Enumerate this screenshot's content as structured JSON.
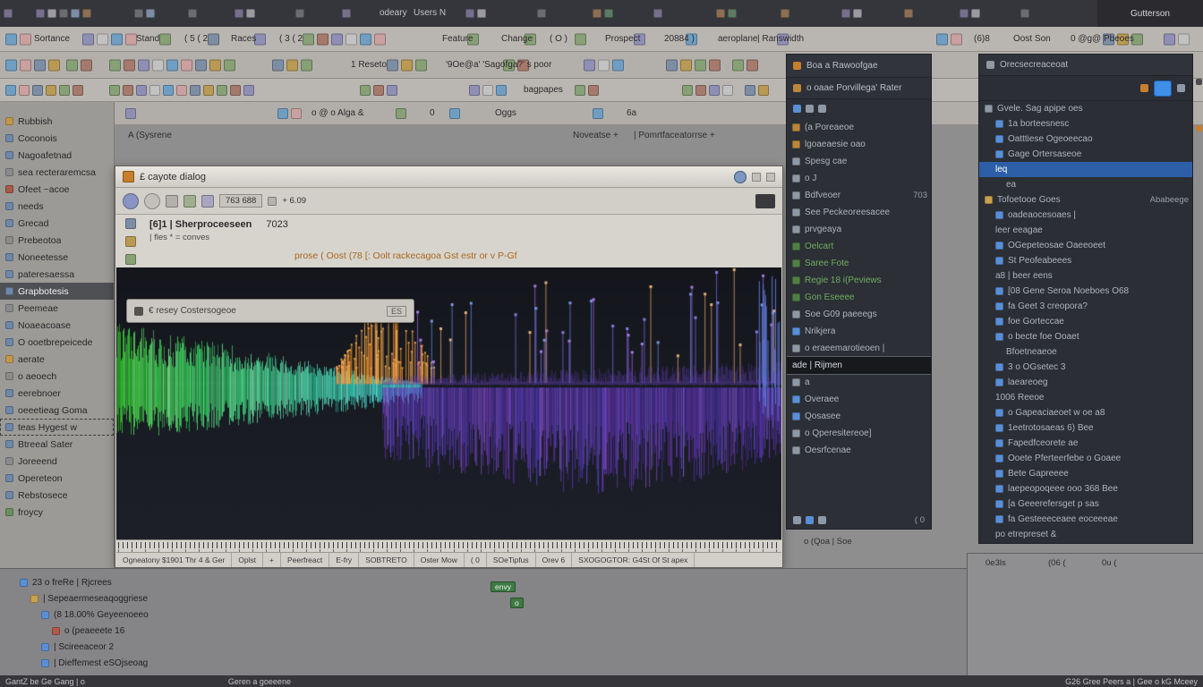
{
  "menubar": {
    "labels": [
      "odeary",
      "Users N"
    ],
    "right_label": "Gutterson"
  },
  "toolbar1": {
    "labels": [
      "Sortance",
      "Stand",
      "( 5 ( 2",
      "Races",
      "( 3 ( 2",
      "Feature",
      "Change",
      "( O )",
      "Prospect",
      "20884 )",
      "aeroplane",
      "| Ranswidth",
      "(6)8",
      "Oost Son",
      "0 @g@ Pbeoes"
    ]
  },
  "toolbar2": {
    "labels": [
      "1 Reseto",
      "'9Oe@a' 'Sagofga?' s poor"
    ]
  },
  "toolbar3": {
    "labels": [
      "bagpapes"
    ]
  },
  "address_row": {
    "labels": [
      "o @ o Alga &",
      "0",
      "Oggs",
      "6a"
    ]
  },
  "sub_row": {
    "labels": [
      "A (Sysrene",
      "Noveatse +",
      "| Pomrtfaceatorrse +"
    ]
  },
  "sidebar": {
    "items": [
      {
        "t": "Rubbish",
        "c": "#c2974d"
      },
      {
        "t": "Coconois",
        "c": "#6f87a8"
      },
      {
        "t": "Nagoafetnad",
        "c": "#6f87a8"
      },
      {
        "t": "sea recteraremcsa",
        "c": "#8b8b8b"
      },
      {
        "t": "Ofeet ~acoe",
        "c": "#a85a4a"
      },
      {
        "t": "needs",
        "c": "#6f87a8"
      },
      {
        "t": "Grecad",
        "c": "#6f87a8"
      },
      {
        "t": "Prebeotoa",
        "c": "#8b8b8b"
      },
      {
        "t": "Noneetesse",
        "c": "#6f87a8"
      },
      {
        "t": "pateresaessa",
        "c": "#6f87a8"
      },
      {
        "t": "Grapbotesis",
        "c": "#6f87a8",
        "sel": "dark"
      },
      {
        "t": "Peemeae",
        "c": "#8b8b8b"
      },
      {
        "t": "Noaeacoase",
        "c": "#6f87a8"
      },
      {
        "t": "O ooetbrepeicede",
        "c": "#6f87a8"
      },
      {
        "t": "aerate",
        "c": "#c2974d"
      },
      {
        "t": "o aeoech",
        "c": "#8b8b8b"
      },
      {
        "t": "eerebnoer",
        "c": "#6f87a8"
      },
      {
        "t": "oeeetieag Goma",
        "c": "#6f87a8"
      },
      {
        "t": "teas Hygest w",
        "c": "#6f87a8",
        "sel": "outline"
      },
      {
        "t": "Btreeal Sater",
        "c": "#6f87a8"
      },
      {
        "t": "Joreeend",
        "c": "#8b8b8b"
      },
      {
        "t": "Opereteon",
        "c": "#6f87a8"
      },
      {
        "t": "Rebstosece",
        "c": "#6f87a8"
      },
      {
        "t": "froycy",
        "c": "#6a8f5f"
      }
    ]
  },
  "window": {
    "title": "£ cayote dialog",
    "toolbar": {
      "value1": "763 688",
      "value2": "+ 6.09"
    },
    "header": {
      "line1": "[6]1 | Sherproceeseen",
      "value": "7023",
      "line2": "| fles * = conves",
      "banner": "prose ( Oost (78 [: Oolt rackecagoa Gst estr or v P-Gf"
    },
    "search": {
      "text": "€ resey Costersogeoe",
      "badge": "ES"
    },
    "statusbar": [
      "Ogneatony $1901 Thr 4 & Ger",
      "Oplst",
      "+",
      "Peerfreact",
      "E-fry",
      "SOBTRETO",
      "Oster Mow",
      "( 0",
      "SOeTipfus",
      "Orev 6",
      "SXOGOGTOR: G4St Of St apex"
    ]
  },
  "spectrogram": {
    "bg_top": "#14161c",
    "bg_bottom": "#1d2029",
    "baseline_frac": 0.435,
    "left_band": {
      "color_start": 118,
      "color_end": 186,
      "x0": 0.0,
      "x1": 0.46
    },
    "orange_cluster": {
      "x0": 0.33,
      "x1": 0.48,
      "hue": 32
    },
    "upper_spikes": {
      "x0": 0.45,
      "x1": 1.0,
      "hues": [
        250,
        265,
        225,
        30
      ]
    },
    "purple_band": {
      "x0": 0.4,
      "x1": 1.0,
      "hue": 258
    },
    "seed": 7
  },
  "right_panel1": {
    "header1": "Boa a Rawoofgae",
    "header2": "o oaae Porvillega' Rater",
    "items": [
      {
        "t": "(a Poreaeoe",
        "c": "#b8873b"
      },
      {
        "t": "lgoaeaesie oao",
        "c": "#b8873b"
      },
      {
        "t": "Spesg cae",
        "c": "#8f98a5"
      },
      {
        "t": "o J",
        "c": "#8f98a5"
      },
      {
        "t": "Bdfveoer",
        "c": "#8f98a5",
        "r": "703"
      },
      {
        "t": "See Peckeoreesacee",
        "c": "#8f98a5"
      },
      {
        "t": "prvgeaya",
        "c": "#8f98a5"
      },
      {
        "t": "Oelcart",
        "c": "#4f7f45",
        "fg": "#6fae5f"
      },
      {
        "t": "Saree Fote",
        "c": "#4f7f45",
        "fg": "#6fae5f"
      },
      {
        "t": "Regie 18 i(Peviews",
        "c": "#4f7f45",
        "fg": "#6fae5f"
      },
      {
        "t": "Gon Eseeee",
        "c": "#4f7f45",
        "fg": "#6fae5f"
      },
      {
        "t": "Soe G09 paeeegs",
        "c": "#8f98a5"
      },
      {
        "t": "Nrikjera",
        "c": "#5a8fd6"
      },
      {
        "t": "o eraeemarotieoen |",
        "c": "#8f98a5"
      },
      {
        "t": "ade | Rijmen",
        "sel": "tooltip"
      },
      {
        "t": "a",
        "c": "#8f98a5"
      },
      {
        "t": "Overaee",
        "c": "#5a8fd6"
      },
      {
        "t": "Qosasee",
        "c": "#5a8fd6"
      },
      {
        "t": "o Qperesitereoe]",
        "c": "#8f98a5"
      },
      {
        "t": "Oesrfcenae",
        "c": "#8f98a5"
      }
    ],
    "footer_value": "( 0"
  },
  "mid_strip": {
    "label": "o    (Qoa    | Soe"
  },
  "right_panel2": {
    "header": "Orecsecreaceoat",
    "items": [
      {
        "t": "Gvele. Sag apipe oes",
        "i": 0,
        "c": "#8f98a5"
      },
      {
        "t": "1a borteesnesc",
        "i": 1,
        "c": "#5a8fd6"
      },
      {
        "t": "Oatttiese Ogeoeecao",
        "i": 1,
        "c": "#5a8fd6"
      },
      {
        "t": "Gage Ortersaseoe",
        "i": 1,
        "c": "#5a8fd6"
      },
      {
        "t": "leq",
        "i": 1,
        "sel": "blue"
      },
      {
        "t": "ea",
        "i": 2
      },
      {
        "t": "Tofoetooe Goes",
        "i": 0,
        "c": "#c9a14d",
        "r": "Ababeege"
      },
      {
        "t": "oadeaocesoaes |",
        "i": 1,
        "c": "#5a8fd6"
      },
      {
        "t": "leer eeagae",
        "i": 1
      },
      {
        "t": "OGepeteosae Oaeeoeet",
        "i": 1,
        "c": "#5a8fd6"
      },
      {
        "t": "St Peofeabeees",
        "i": 1,
        "c": "#5a8fd6"
      },
      {
        "t": "a8 | beer eens",
        "i": 1
      },
      {
        "t": "[08 Gene Seroa Noeboes O68",
        "i": 1,
        "c": "#5a8fd6"
      },
      {
        "t": "fa Geet 3 creopora?",
        "i": 1,
        "c": "#5a8fd6"
      },
      {
        "t": "foe Gorteccae",
        "i": 1,
        "c": "#5a8fd6"
      },
      {
        "t": "o becte foe Ooaet",
        "i": 1,
        "c": "#5a8fd6"
      },
      {
        "t": "Bfoetneaeoe",
        "i": 2
      },
      {
        "t": "3 o OGsetec 3",
        "i": 1,
        "c": "#5a8fd6"
      },
      {
        "t": "laeareoeg",
        "i": 1,
        "c": "#5a8fd6"
      },
      {
        "t": "1006 Reeoe",
        "i": 1
      },
      {
        "t": "o Gapeaciaeoet w oe a8",
        "i": 1,
        "c": "#5a8fd6"
      },
      {
        "t": "1eetrotosaeas 6) Bee",
        "i": 1,
        "c": "#5a8fd6"
      },
      {
        "t": "Fapedfceorete ae",
        "i": 1,
        "c": "#5a8fd6"
      },
      {
        "t": "Ooete Pferteerfebe o Goaee",
        "i": 1,
        "c": "#5a8fd6"
      },
      {
        "t": "Bete Gapreeee",
        "i": 1,
        "c": "#5a8fd6"
      },
      {
        "t": "laepeopoqeee ooo 368 Bee",
        "i": 1,
        "c": "#5a8fd6"
      },
      {
        "t": "[a Geeerefersget p sas",
        "i": 1,
        "c": "#5a8fd6"
      },
      {
        "t": "fa Gesteeeceaee eoceeeae",
        "i": 1,
        "c": "#5a8fd6"
      },
      {
        "t": "po etrepreset &",
        "i": 1
      }
    ]
  },
  "bottom_panel": {
    "items": [
      {
        "t": "23 o freRe | Rjcrees",
        "i": 0,
        "c": "#5a8fd6"
      },
      {
        "t": "| Sepeaermeseaqoggriese",
        "i": 1,
        "c": "#c9a14d"
      },
      {
        "t": "(8 18.00% Geyeenoeeo",
        "i": 2,
        "c": "#5a8fd6"
      },
      {
        "t": "o (peaeeete 16",
        "i": 3,
        "c": "#b05a4a"
      },
      {
        "t": "| Scireeaceor 2",
        "i": 2,
        "c": "#5a8fd6"
      },
      {
        "t": "| Dieffemest eSOjseoag",
        "i": 2,
        "c": "#5a8fd6"
      }
    ],
    "chips": [
      "envy",
      "o"
    ]
  },
  "bottom_right": {
    "labels": [
      "0e3ls",
      "(06 (",
      "0u ("
    ]
  },
  "statusbar": {
    "left": "GantZ be Ge Gang |   o",
    "mid": "Geren a goeeene",
    "right": "G26 Gree Peers a | Gee o kG Mceey"
  }
}
